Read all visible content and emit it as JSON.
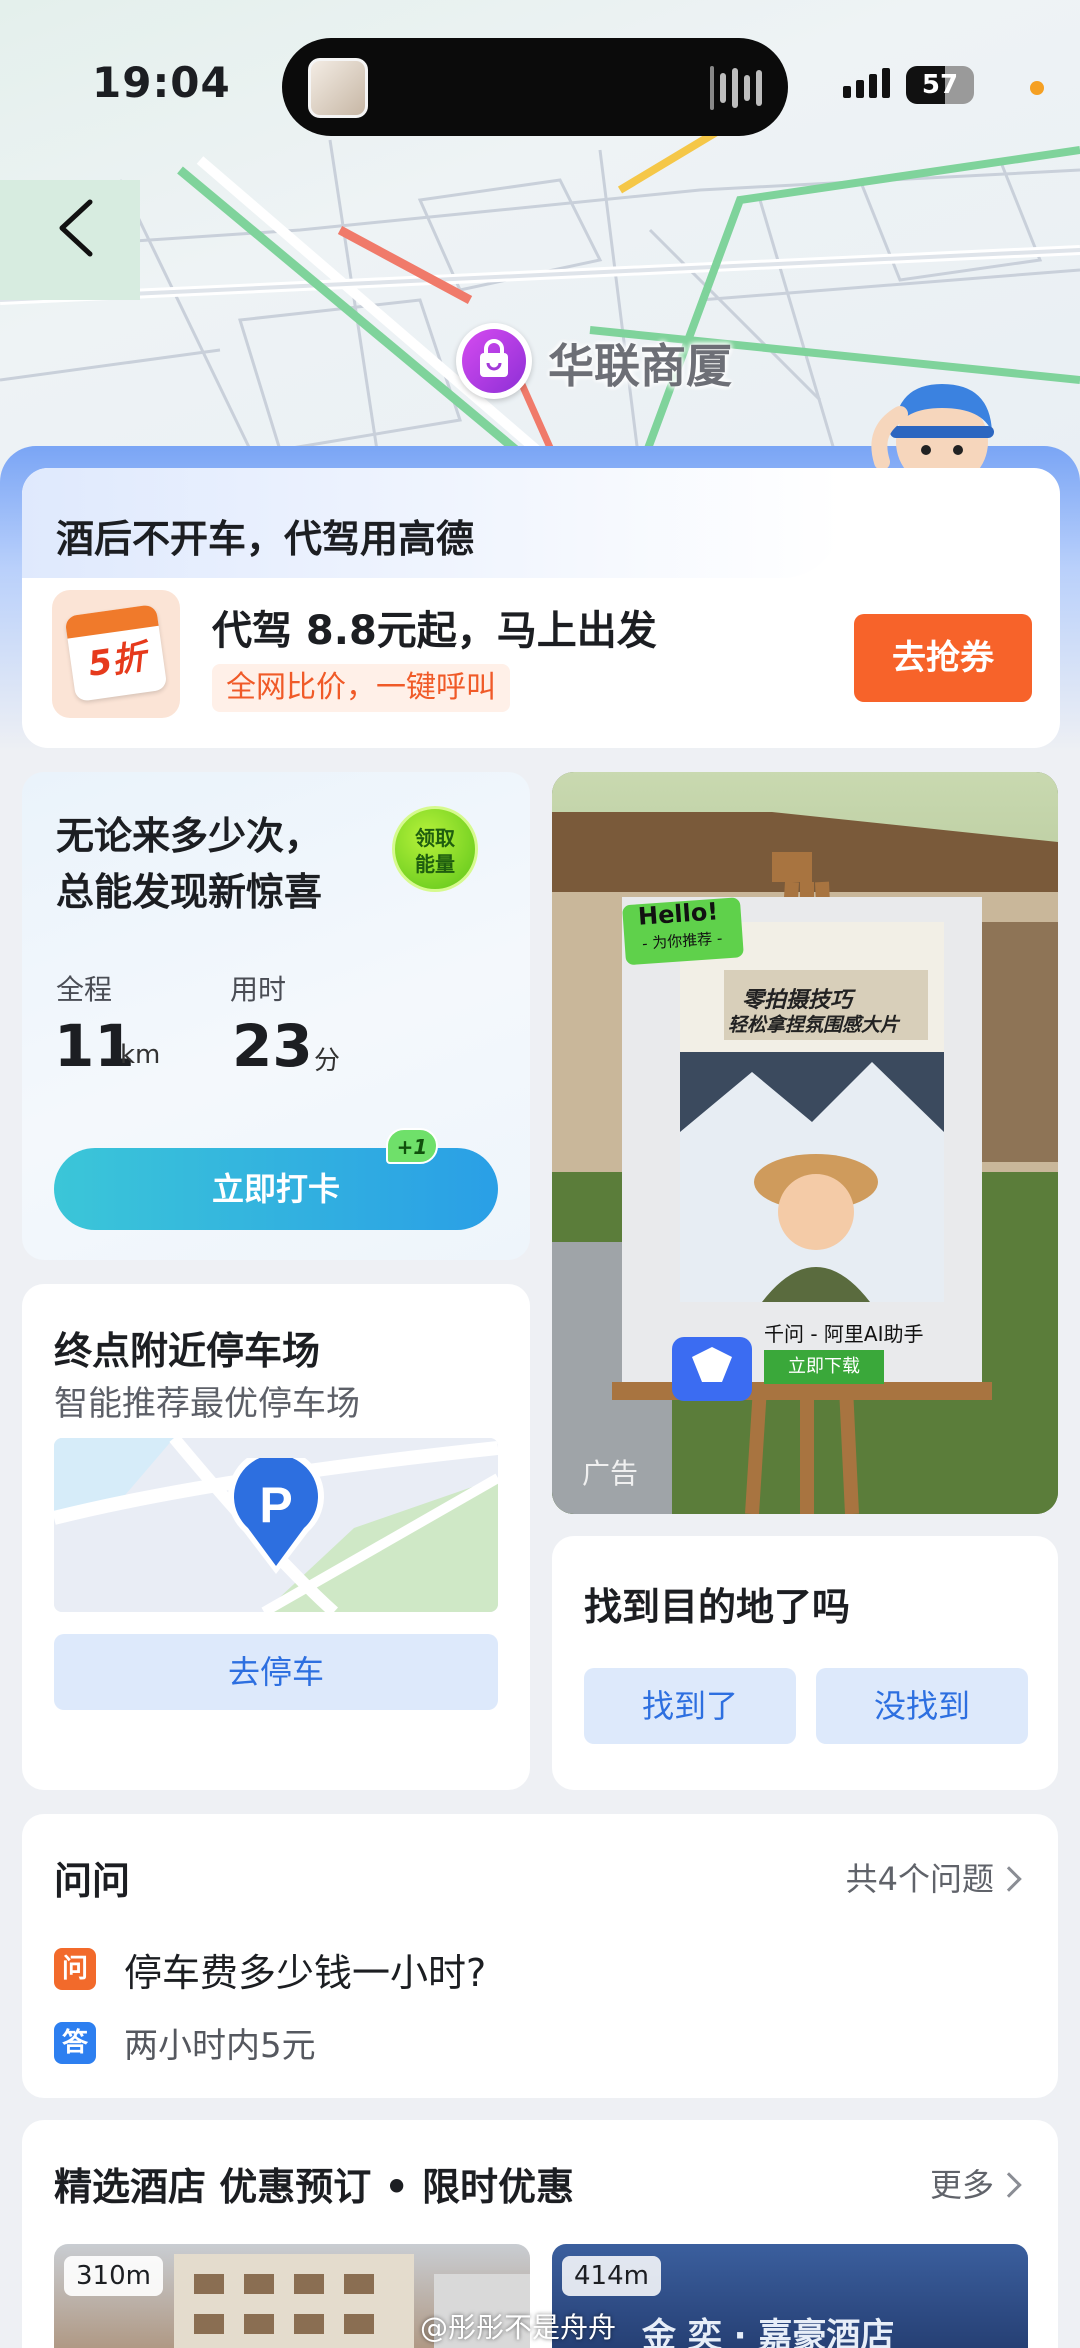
{
  "status_bar": {
    "time": "19:04",
    "battery": "57"
  },
  "map": {
    "poi_name": "华联商厦"
  },
  "promo": {
    "title": "酒后不开车，代驾用高德",
    "icon_text": "5折",
    "headline": "代驾 8.8元起，马上出发",
    "subtitle": "全网比价，一键呼叫",
    "button": "去抢券"
  },
  "checkin": {
    "title_line1": "无论来多少次，",
    "title_line2": "总能发现新惊喜",
    "energy_badge_line1": "领取",
    "energy_badge_line2": "能量",
    "distance_label": "全程",
    "distance_value": "11",
    "distance_unit": "km",
    "duration_label": "用时",
    "duration_value": "23",
    "duration_unit": "分",
    "button": "立即打卡",
    "bonus": "+1"
  },
  "parking": {
    "title": "终点附近停车场",
    "subtitle": "智能推荐最优停车场",
    "pin_letter": "P",
    "button": "去停车"
  },
  "ad": {
    "hello": "Hello!",
    "hello_sub": "- 为你推荐 -",
    "headline_line1": "零拍摄技巧",
    "headline_line2": "轻松拿捏氛围感大片",
    "app_name": "千问 - 阿里AI助手",
    "download": "立即下载",
    "label": "广告"
  },
  "found": {
    "title": "找到目的地了吗",
    "yes": "找到了",
    "no": "没找到"
  },
  "qa": {
    "title": "问问",
    "more": "共4个问题",
    "q_tag": "问",
    "question": "停车费多少钱一小时?",
    "a_tag": "答",
    "answer": "两小时内5元"
  },
  "hotels": {
    "title": "精选酒店 优惠预订 • 限时优惠",
    "more": "更多",
    "items": [
      {
        "distance": "310m"
      },
      {
        "distance": "414m",
        "sign": "金 奕 · 嘉豪酒店"
      }
    ]
  },
  "watermark": "@彤彤不是舟舟",
  "colors": {
    "accent_blue": "#2d6fe0",
    "promo_orange": "#f7632a",
    "checkin_teal": "#2a9fe6",
    "poi_purple": "#b43fe6"
  }
}
